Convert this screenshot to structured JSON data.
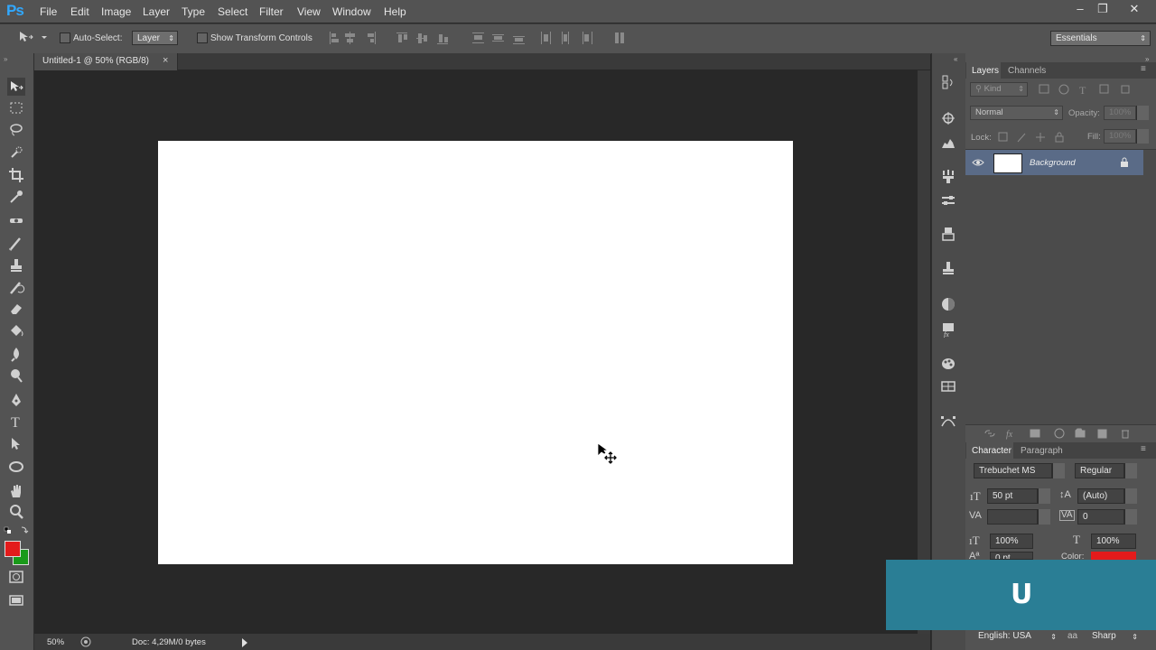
{
  "app": {
    "logo": "Ps"
  },
  "menu": [
    "File",
    "Edit",
    "Image",
    "Layer",
    "Type",
    "Select",
    "Filter",
    "View",
    "Window",
    "Help"
  ],
  "window_controls": {
    "minimize": "–",
    "restore": "❐",
    "close": "✕"
  },
  "options_bar": {
    "auto_select_label": "Auto-Select:",
    "auto_select_value": "Layer",
    "show_transform_label": "Show Transform Controls",
    "workspace": "Essentials"
  },
  "document_tab": {
    "title": "Untitled-1 @ 50% (RGB/8)",
    "close": "×"
  },
  "status_bar": {
    "zoom": "50%",
    "doc_info": "Doc: 4,29M/0 bytes"
  },
  "colors": {
    "foreground": "#e31b1b",
    "background": "#1a9a1a",
    "overlay": "#2a7e95"
  },
  "layers_panel": {
    "tabs": [
      "Layers",
      "Channels"
    ],
    "filter_kind": "Kind",
    "blend_mode": "Normal",
    "opacity_label": "Opacity:",
    "opacity_value": "100%",
    "lock_label": "Lock:",
    "fill_label": "Fill:",
    "fill_value": "100%",
    "layers": [
      {
        "name": "Background",
        "visible": true,
        "locked": true
      }
    ]
  },
  "character_panel": {
    "tabs": [
      "Character",
      "Paragraph"
    ],
    "font_family": "Trebuchet MS",
    "font_style": "Regular",
    "font_size": "50 pt",
    "leading": "(Auto)",
    "kerning": "",
    "tracking": "0",
    "vertical_scale": "100%",
    "horizontal_scale": "100%",
    "baseline_shift": "0 pt",
    "color_label": "Color:",
    "color_value": "#e31b1b",
    "language": "English: USA",
    "antialias_icon": "aa",
    "antialias": "Sharp"
  },
  "overlay": {
    "letter": "U"
  }
}
